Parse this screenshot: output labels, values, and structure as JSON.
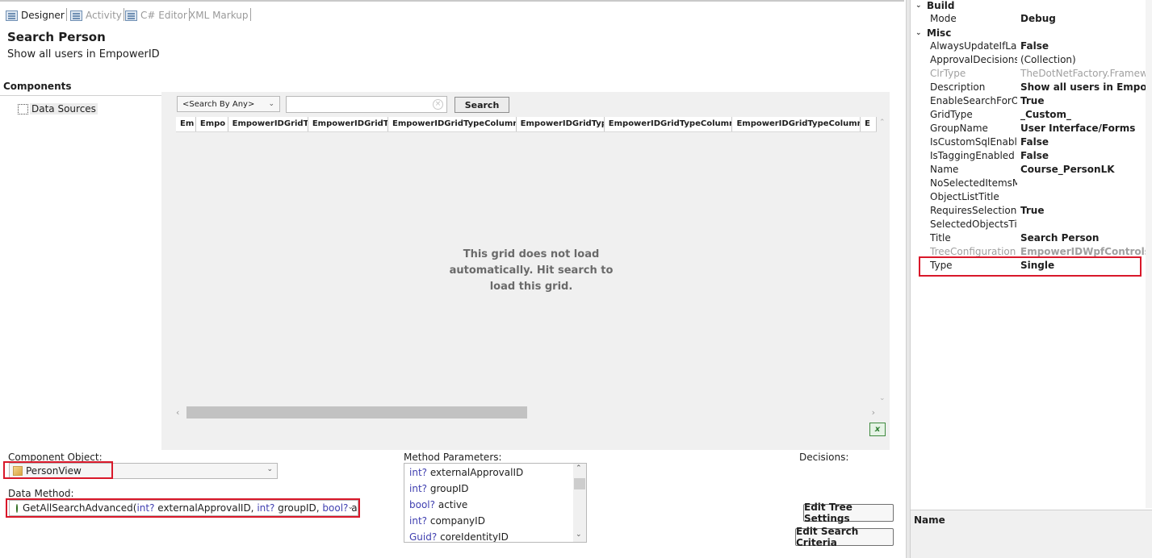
{
  "tabs": [
    {
      "label": "Designer",
      "active": true
    },
    {
      "label": "Activity",
      "active": false
    },
    {
      "label": "C# Editor",
      "active": false
    },
    {
      "label": "XML Markup",
      "active": false
    }
  ],
  "form": {
    "title": "Search Person",
    "description": "Show all users in EmpowerID"
  },
  "components": {
    "header": "Components",
    "tree_item": "Data Sources"
  },
  "grid": {
    "search_by": "<Search By Any>",
    "search_value": "",
    "search_button": "Search",
    "columns": [
      "Em",
      "Empo",
      "EmpowerIDGridTy",
      "EmpowerIDGridTy",
      "EmpowerIDGridTypeColumns_",
      "EmpowerIDGridTyp",
      "EmpowerIDGridTypeColumns_",
      "EmpowerIDGridTypeColumns_",
      "E"
    ],
    "message": "This grid does not load automatically. Hit search to load this grid.",
    "excel_icon": "excel-export-icon"
  },
  "config": {
    "component_object_label": "Component Object:",
    "component_object_value": "PersonView",
    "data_method_label": "Data Method:",
    "data_method_value": {
      "name": "GetAllSearchAdvanced",
      "open": "(",
      "t1": "int?",
      "p1": " externalApprovalID, ",
      "t2": "int?",
      "p2": " groupID, ",
      "t3": "bool?",
      "p3": " active"
    },
    "method_parameters_label": "Method Parameters:",
    "parameters": [
      {
        "type": "int?",
        "name": "externalApprovalID"
      },
      {
        "type": "int?",
        "name": "groupID"
      },
      {
        "type": "bool?",
        "name": "active"
      },
      {
        "type": "int?",
        "name": "companyID"
      },
      {
        "type": "Guid?",
        "name": "coreIdentityID"
      }
    ],
    "decisions_label": "Decisions:",
    "edit_tree_button": "Edit Tree Settings",
    "edit_search_button": "Edit Search Criteria"
  },
  "properties": {
    "categories": [
      {
        "name": "Build",
        "expander": "⌄"
      },
      {
        "name": "Misc",
        "expander": "⌄"
      }
    ],
    "build": [
      {
        "name": "Mode",
        "value": "Debug",
        "bold": true
      }
    ],
    "misc": [
      {
        "name": "AlwaysUpdateIfLaz",
        "value": "False",
        "bold": true
      },
      {
        "name": "ApprovalDecisions",
        "value": "(Collection)",
        "bold": false
      },
      {
        "name": "ClrType",
        "value": "TheDotNetFactory.Framework",
        "bold": false,
        "dim": true
      },
      {
        "name": "Description",
        "value": "Show all users in EmpowerID",
        "bold": true
      },
      {
        "name": "EnableSearchForOl",
        "value": "True",
        "bold": true
      },
      {
        "name": "GridType",
        "value": "_Custom_",
        "bold": true
      },
      {
        "name": "GroupName",
        "value": "User Interface/Forms",
        "bold": true
      },
      {
        "name": "IsCustomSqlEnable",
        "value": "False",
        "bold": true
      },
      {
        "name": "IsTaggingEnabled",
        "value": "False",
        "bold": true
      },
      {
        "name": "Name",
        "value": "Course_PersonLK",
        "bold": true
      },
      {
        "name": "NoSelectedItemsM",
        "value": "",
        "bold": false
      },
      {
        "name": "ObjectListTitle",
        "value": "",
        "bold": false
      },
      {
        "name": "RequiresSelection",
        "value": "True",
        "bold": true
      },
      {
        "name": "SelectedObjectsTit",
        "value": "",
        "bold": false
      },
      {
        "name": "Title",
        "value": "Search Person",
        "bold": true
      },
      {
        "name": "TreeConfiguration",
        "value": "EmpowerIDWpfControls.T",
        "bold": true,
        "dim": true
      },
      {
        "name": "Type",
        "value": "Single",
        "bold": true
      }
    ],
    "description_panel_title": "Name"
  }
}
